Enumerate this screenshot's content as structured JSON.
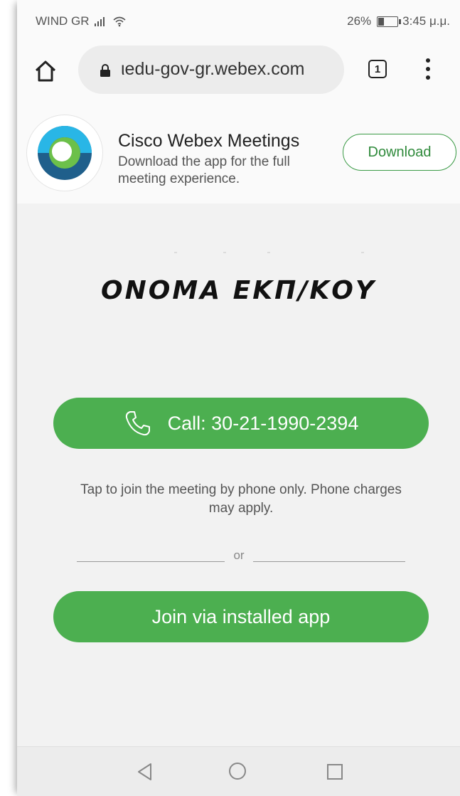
{
  "status_bar": {
    "carrier": "WIND GR",
    "battery_percent": "26%",
    "time": "3:45 μ.μ."
  },
  "browser": {
    "url": "ιedu-gov-gr.webex.com",
    "tab_count": "1"
  },
  "banner": {
    "app_name": "Cisco Webex Meetings",
    "description": "Download the app for the full meeting experience.",
    "download_label": "Download"
  },
  "meeting": {
    "title": "ONOMA ΕΚΠ/ΚΟΥ",
    "call_label": "Call: 30-21-1990-2394",
    "help_text": "Tap to join the meeting by phone only. Phone charges may apply.",
    "divider_label": "or",
    "join_label": "Join via installed app"
  },
  "colors": {
    "accent_green": "#4caf50",
    "logo_dark_blue": "#1f5f8b",
    "logo_light_blue": "#29b6e6",
    "logo_green": "#6cc04a"
  }
}
